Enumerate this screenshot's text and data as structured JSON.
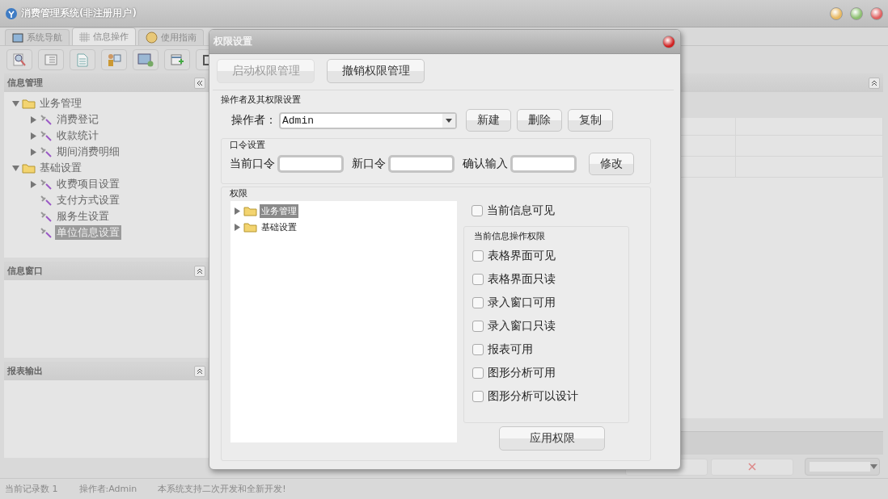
{
  "window": {
    "title": "消费管理系统(非注册用户)"
  },
  "tabs": [
    {
      "label": "系统导航",
      "selected": false
    },
    {
      "label": "信息操作",
      "selected": true
    },
    {
      "label": "使用指南",
      "selected": false
    }
  ],
  "left_panels": [
    {
      "title": "信息管理",
      "tree": [
        {
          "label": "业务管理",
          "kind": "folder",
          "expanded": true,
          "selected": false,
          "children": [
            {
              "label": "消费登记",
              "kind": "item",
              "expanded": false,
              "selected": false
            },
            {
              "label": "收款统计",
              "kind": "item",
              "expanded": false,
              "selected": false
            },
            {
              "label": "期间消费明细",
              "kind": "item",
              "expanded": false,
              "selected": false
            }
          ]
        },
        {
          "label": "基础设置",
          "kind": "folder",
          "expanded": true,
          "selected": false,
          "children": [
            {
              "label": "收费项目设置",
              "kind": "item",
              "expanded": false,
              "selected": false
            },
            {
              "label": "支付方式设置",
              "kind": "item",
              "selected": false
            },
            {
              "label": "服务生设置",
              "kind": "item",
              "selected": false
            },
            {
              "label": "单位信息设置",
              "kind": "item",
              "selected": true
            }
          ]
        }
      ]
    },
    {
      "title": "信息窗口"
    },
    {
      "title": "报表输出"
    }
  ],
  "status_bar": [
    "当前记录数 1",
    "操作者:Admin",
    "本系统支持二次开发和全新开发!"
  ],
  "dialog": {
    "title": "权限设置",
    "buttons": [
      {
        "label": "启动权限管理",
        "disabled": true
      },
      {
        "label": "撤销权限管理",
        "disabled": false
      }
    ],
    "operator_group": {
      "title": "操作者及其权限设置",
      "label": "操作者：",
      "value": "Admin",
      "buttons": [
        "新建",
        "删除",
        "复制"
      ]
    },
    "password_group": {
      "title": "口令设置",
      "fields": [
        {
          "label": "当前口令"
        },
        {
          "label": "新口令"
        },
        {
          "label": "确认输入"
        }
      ],
      "button": "修改"
    },
    "permissions": {
      "title": "权限",
      "tree": [
        {
          "label": "业务管理",
          "selected": true
        },
        {
          "label": "基础设置",
          "selected": false
        }
      ],
      "visible_option": {
        "label": "当前信息可见",
        "checked": false
      },
      "operation_group": {
        "title": "当前信息操作权限",
        "options": [
          {
            "label": "表格界面可见",
            "checked": false
          },
          {
            "label": "表格界面只读",
            "checked": false
          },
          {
            "label": "录入窗口可用",
            "checked": false
          },
          {
            "label": "录入窗口只读",
            "checked": false
          },
          {
            "label": "报表可用",
            "checked": false
          },
          {
            "label": "图形分析可用",
            "checked": false
          },
          {
            "label": "图形分析可以设计",
            "checked": false
          }
        ]
      },
      "apply_button": "应用权限"
    }
  }
}
